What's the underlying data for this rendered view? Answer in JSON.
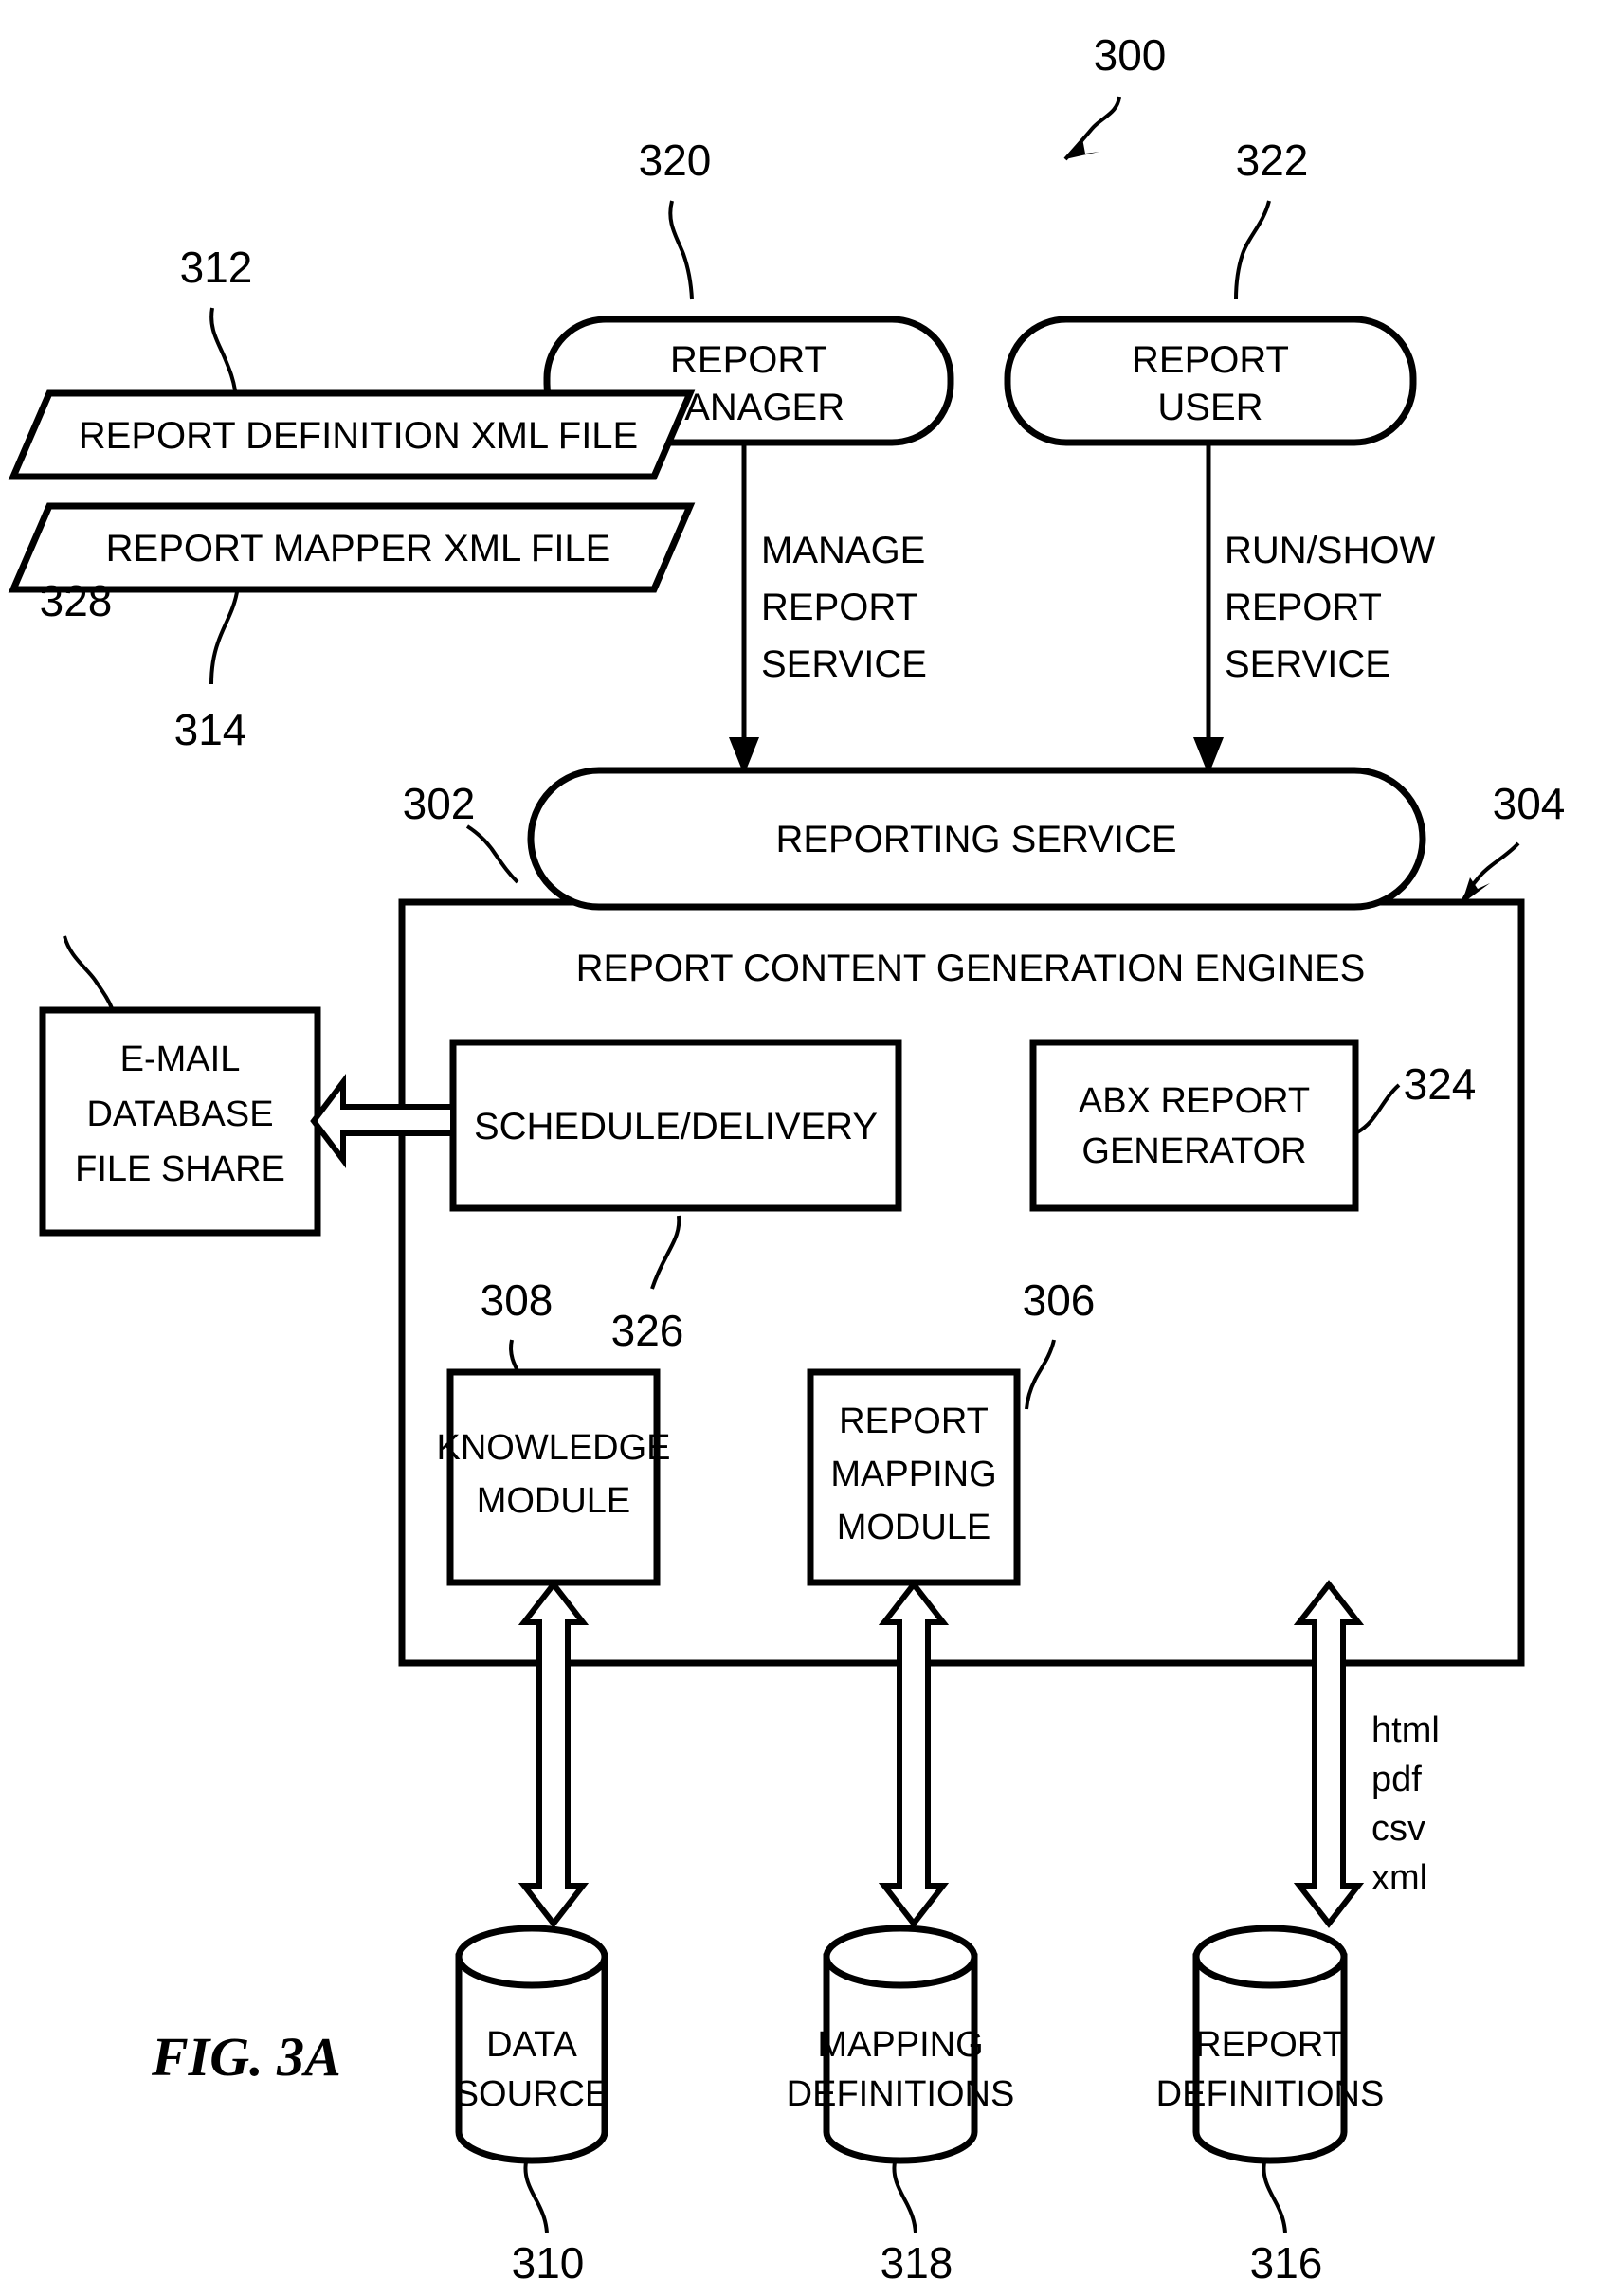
{
  "figure": {
    "caption": "FIG. 3A",
    "diagram_ref": "300"
  },
  "nodes": {
    "report_manager": {
      "label_line1": "REPORT",
      "label_line2": "MANAGER",
      "ref": "320"
    },
    "report_user": {
      "label_line1": "REPORT",
      "label_line2": "USER",
      "ref": "322"
    },
    "report_definition_xml": {
      "label": "REPORT DEFINITION XML FILE",
      "ref": "312"
    },
    "report_mapper_xml": {
      "label": "REPORT MAPPER XML FILE",
      "ref": "314"
    },
    "reporting_service": {
      "label": "REPORTING SERVICE",
      "ref": "302"
    },
    "engines_container": {
      "label": "REPORT CONTENT GENERATION ENGINES",
      "ref": "304"
    },
    "email_db_fileshare": {
      "label_line1": "E-MAIL",
      "label_line2": "DATABASE",
      "label_line3": "FILE SHARE",
      "ref": "328"
    },
    "schedule_delivery": {
      "label": "SCHEDULE/DELIVERY",
      "ref": "326"
    },
    "abx_report_generator": {
      "label_line1": "ABX REPORT",
      "label_line2": "GENERATOR",
      "ref": "324"
    },
    "knowledge_module": {
      "label_line1": "KNOWLEDGE",
      "label_line2": "MODULE",
      "ref": "308"
    },
    "report_mapping_module": {
      "label_line1": "REPORT",
      "label_line2": "MAPPING",
      "label_line3": "MODULE",
      "ref": "306"
    },
    "data_source": {
      "label_line1": "DATA",
      "label_line2": "SOURCE",
      "ref": "310"
    },
    "mapping_definitions": {
      "label_line1": "MAPPING",
      "label_line2": "DEFINITIONS",
      "ref": "318"
    },
    "report_definitions": {
      "label_line1": "REPORT",
      "label_line2": "DEFINITIONS",
      "ref": "316"
    }
  },
  "edges": {
    "manage_report_service": {
      "line1": "MANAGE",
      "line2": "REPORT",
      "line3": "SERVICE"
    },
    "run_show_report_service": {
      "line1": "RUN/SHOW",
      "line2": "REPORT",
      "line3": "SERVICE"
    },
    "output_formats": {
      "f1": "html",
      "f2": "pdf",
      "f3": "csv",
      "f4": "xml"
    }
  },
  "colors": {
    "ink": "#000000",
    "paper": "#ffffff"
  }
}
